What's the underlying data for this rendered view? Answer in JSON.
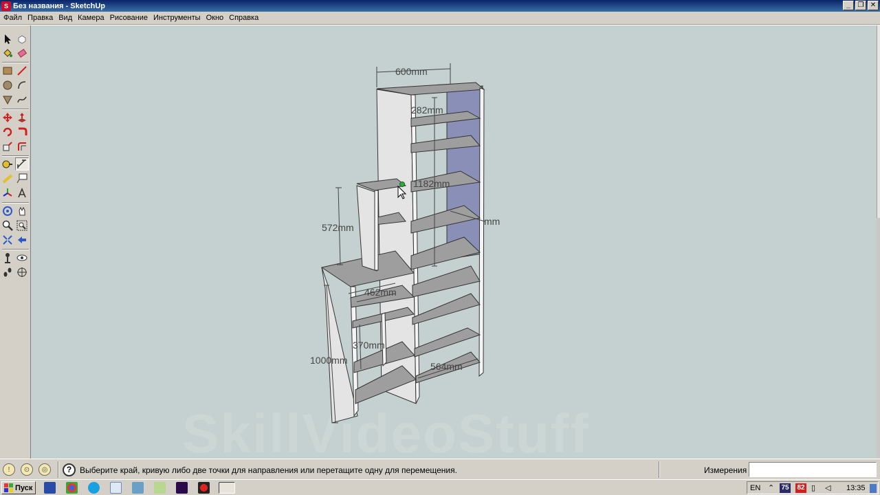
{
  "window": {
    "title": "Без названия - SketchUp",
    "app_icon": "sketchup-icon",
    "controls": [
      "minimize",
      "restore",
      "close"
    ]
  },
  "menu": {
    "items": [
      "Файл",
      "Правка",
      "Вид",
      "Камера",
      "Рисование",
      "Инструменты",
      "Окно",
      "Справка"
    ]
  },
  "toolbar": {
    "tools": [
      "select-icon",
      "make-component-icon",
      "paint-bucket-icon",
      "eraser-icon",
      "rectangle-icon",
      "line-icon",
      "circle-icon",
      "arc-icon",
      "polygon-icon",
      "freehand-icon",
      "move-icon",
      "push-pull-icon",
      "rotate-icon",
      "follow-me-icon",
      "scale-icon",
      "offset-icon",
      "tape-measure-icon",
      "dimension-icon",
      "protractor-icon",
      "text-icon",
      "axes-icon",
      "3d-text-icon",
      "orbit-icon",
      "pan-icon",
      "zoom-icon",
      "zoom-window-icon",
      "zoom-extents-icon",
      "previous-view-icon",
      "position-camera-icon",
      "look-around-icon",
      "walk-icon",
      "section-plane-icon"
    ],
    "active_tool": "dimension-icon"
  },
  "model": {
    "dimensions": [
      "600mm",
      "282mm",
      "1182mm",
      "572mm",
      "mm",
      "462mm",
      "370mm",
      "1000mm",
      "564mm"
    ]
  },
  "watermark": "SkillVideoStuff",
  "status": {
    "message": "Выберите край, кривую либо две точки для направления или перетащите одну для перемещения.",
    "measure_label": "Измерения",
    "measure_value": ""
  },
  "taskbar": {
    "start_label": "Пуск",
    "apps": [
      "save-icon",
      "chrome-icon",
      "skype-icon",
      "notepad-icon",
      "monitor-icon",
      "file-icon",
      "premiere-icon",
      "record-icon",
      "sketchup-icon"
    ],
    "tray": {
      "language": "EN",
      "badge1": "75",
      "badge2": "82",
      "clock": "13:35"
    }
  },
  "colors": {
    "viewport": "#c5d1d0",
    "panel_face": "#e4e4e4",
    "shelf_top": "#9e9e9e",
    "back_panel": "#8a8fb8",
    "titlebar": "#0a246a"
  }
}
